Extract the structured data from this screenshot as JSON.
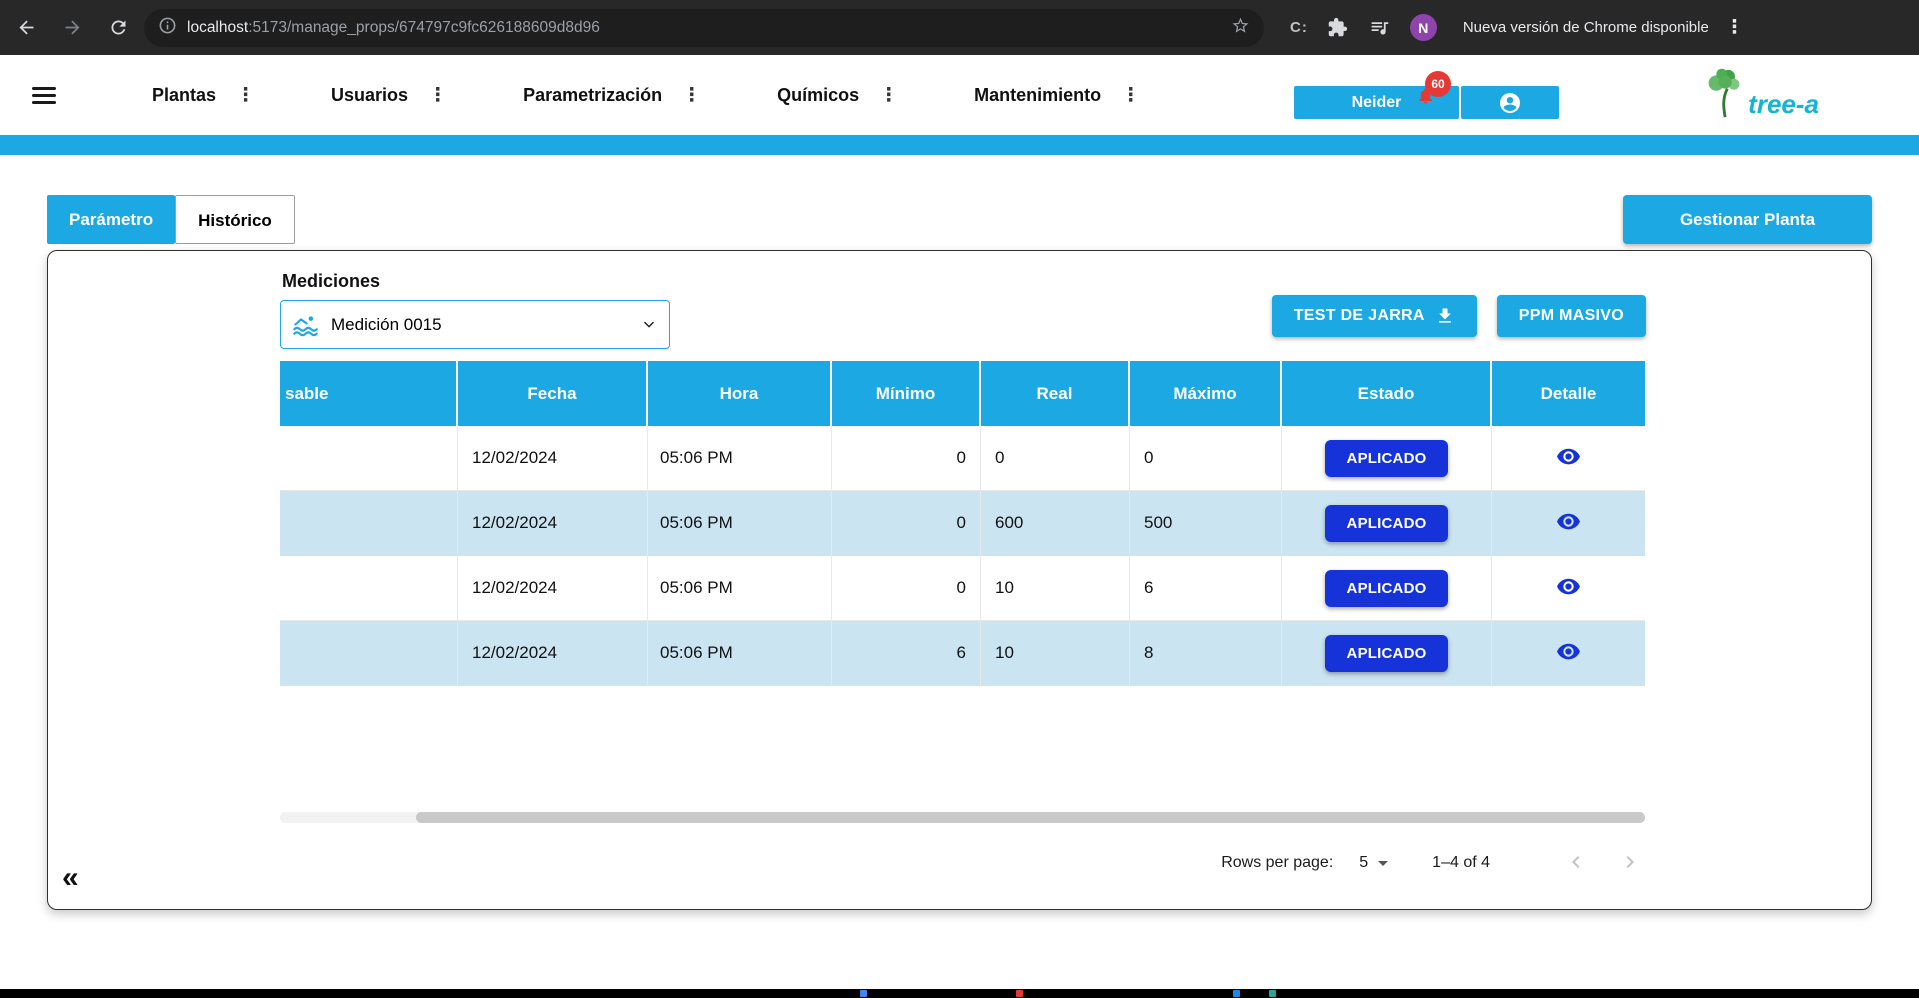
{
  "browser": {
    "url_host": "localhost",
    "url_rest": ":5173/manage_props/674797c9fc626188609d8d96",
    "notification": "Nueva versión de Chrome disponible",
    "avatar_letter": "N"
  },
  "icons": {
    "vertical_dots": "⋮",
    "collapse_double_chevron": "«",
    "c_extension": "C:"
  },
  "nav": {
    "items": [
      {
        "label": "Plantas"
      },
      {
        "label": "Usuarios"
      },
      {
        "label": "Parametrización"
      },
      {
        "label": "Químicos"
      },
      {
        "label": "Mantenimiento"
      }
    ],
    "user_button": "Neider",
    "notification_badge": "60",
    "logo_text": "tree-a"
  },
  "tabs": [
    {
      "label": "Parámetro",
      "active": false
    },
    {
      "label": "Histórico",
      "active": true
    }
  ],
  "actions": {
    "manage_plant": "Gestionar Planta",
    "jar_test": "TEST DE JARRA",
    "ppm_massive": "PPM MASIVO"
  },
  "measurements": {
    "label": "Mediciones",
    "selected": "Medición 0015"
  },
  "table": {
    "columns": [
      "sable",
      "Fecha",
      "Hora",
      "Mínimo",
      "Real",
      "Máximo",
      "Estado",
      "Detalle"
    ],
    "rows": [
      {
        "responsable": "",
        "fecha": "12/02/2024",
        "hora": "05:06 PM",
        "minimo": "0",
        "real": "0",
        "maximo": "0",
        "estado": "APLICADO"
      },
      {
        "responsable": "",
        "fecha": "12/02/2024",
        "hora": "05:06 PM",
        "minimo": "0",
        "real": "600",
        "maximo": "500",
        "estado": "APLICADO"
      },
      {
        "responsable": "",
        "fecha": "12/02/2024",
        "hora": "05:06 PM",
        "minimo": "0",
        "real": "10",
        "maximo": "6",
        "estado": "APLICADO"
      },
      {
        "responsable": "",
        "fecha": "12/02/2024",
        "hora": "05:06 PM",
        "minimo": "6",
        "real": "10",
        "maximo": "8",
        "estado": "APLICADO"
      }
    ]
  },
  "pagination": {
    "rows_per_page_label": "Rows per page:",
    "rows_per_page": "5",
    "range": "1–4 of 4"
  },
  "colors": {
    "accent": "#1BA8E3",
    "applied_blue": "#1533D8",
    "row_alt": "#CBE4F2",
    "badge_red": "#E53935",
    "logo_green": "#4CAF50",
    "logo_cyan": "#14B4D4",
    "avatar_purple": "#8E44AD"
  }
}
